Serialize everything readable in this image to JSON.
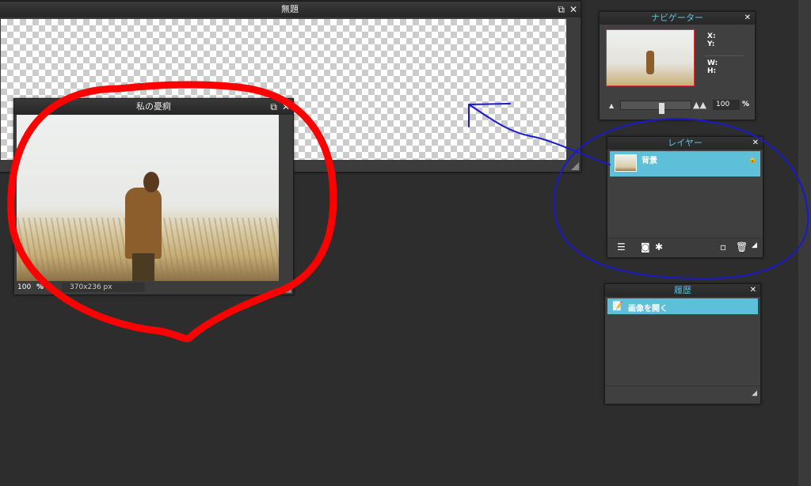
{
  "windows": {
    "untitled": {
      "title": "無題"
    },
    "image": {
      "title": "私の憂痾",
      "zoom": "100",
      "zoom_unit": "%",
      "size": "370x236 px"
    }
  },
  "navigator": {
    "title": "ナビゲーター",
    "x_label": "X:",
    "y_label": "Y:",
    "w_label": "W:",
    "h_label": "H:",
    "zoom_value": "100",
    "zoom_unit": "%"
  },
  "layers": {
    "title": "レイヤー",
    "items": [
      {
        "name": "背景",
        "locked": true
      }
    ]
  },
  "history": {
    "title": "履歴",
    "items": [
      {
        "label": "画像を開く"
      }
    ]
  },
  "colors": {
    "accent": "#5ebfd8",
    "annotation_red": "#ff0000",
    "annotation_blue": "#1a1acc"
  }
}
